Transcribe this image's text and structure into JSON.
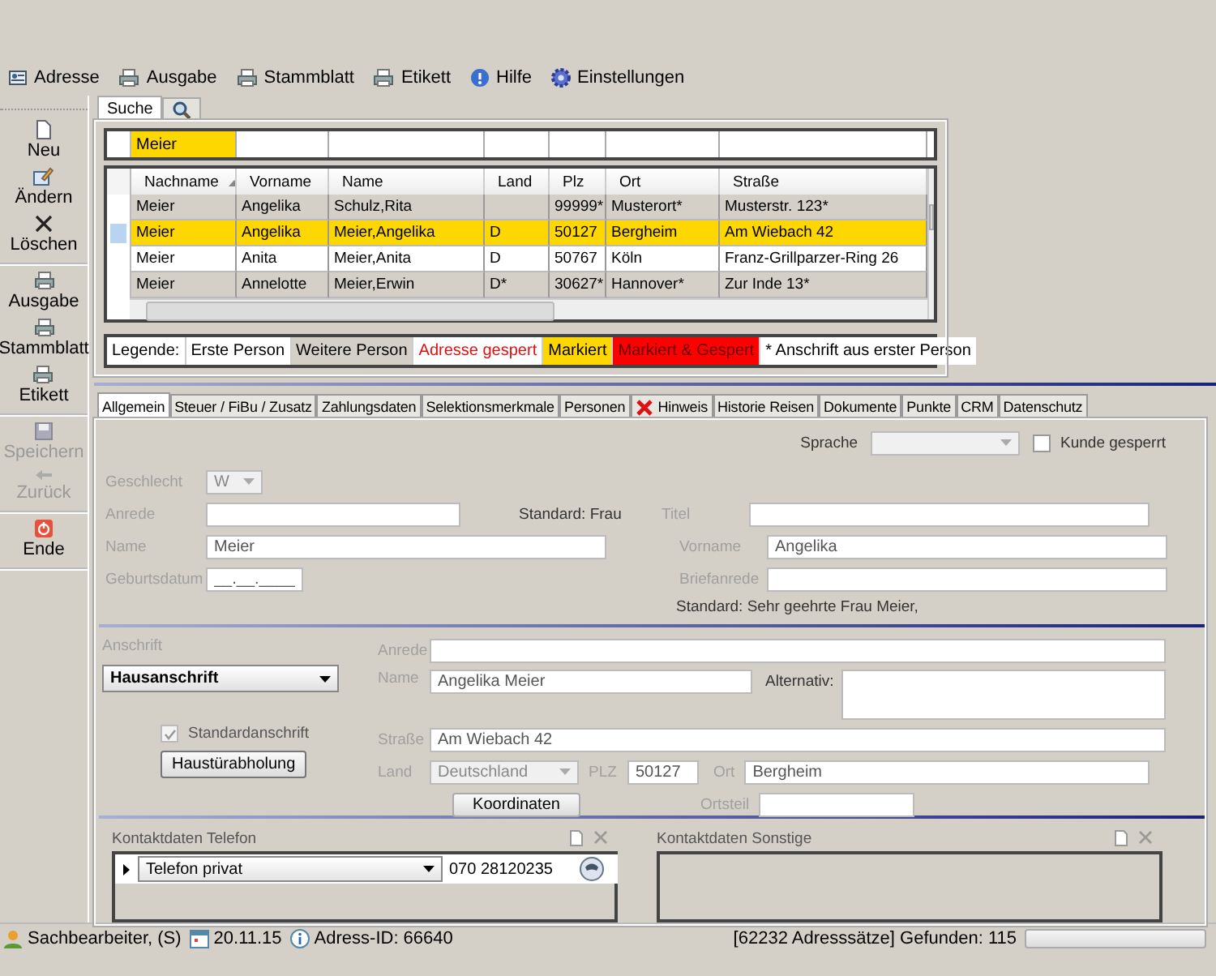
{
  "toolbar": [
    {
      "label": "Adresse",
      "kind": "address"
    },
    {
      "label": "Ausgabe",
      "kind": "print"
    },
    {
      "label": "Stammblatt",
      "kind": "print"
    },
    {
      "label": "Etikett",
      "kind": "print"
    },
    {
      "label": "Hilfe",
      "kind": "help"
    },
    {
      "label": "Einstellungen",
      "kind": "settings"
    }
  ],
  "sidebar": {
    "groups": [
      {
        "items": [
          {
            "label": "Neu",
            "kind": "new",
            "disabled": false
          },
          {
            "label": "Ändern",
            "kind": "edit",
            "disabled": false
          },
          {
            "label": "Löschen",
            "kind": "delete",
            "disabled": false
          }
        ]
      },
      {
        "items": [
          {
            "label": "Ausgabe",
            "kind": "print",
            "disabled": false
          },
          {
            "label": "Stammblatt",
            "kind": "print",
            "disabled": false
          },
          {
            "label": "Etikett",
            "kind": "print",
            "disabled": false
          }
        ]
      },
      {
        "items": [
          {
            "label": "Speichern",
            "kind": "save",
            "disabled": true
          },
          {
            "label": "Zurück",
            "kind": "back",
            "disabled": true
          }
        ]
      },
      {
        "items": [
          {
            "label": "Ende",
            "kind": "exit",
            "disabled": false
          }
        ]
      }
    ]
  },
  "search": {
    "tabs": [
      {
        "label": "Suche",
        "kind": "text",
        "selected": true
      },
      {
        "kind": "search",
        "selected": false
      }
    ],
    "filter": "Meier",
    "columns": [
      {
        "label": "Nachname",
        "sorted": true
      },
      {
        "label": "Vorname",
        "sorted": false
      },
      {
        "label": "Name",
        "sorted": false
      },
      {
        "label": "Land",
        "sorted": false
      },
      {
        "label": "Plz",
        "sorted": false
      },
      {
        "label": "Ort",
        "sorted": false
      },
      {
        "label": "Straße",
        "sorted": false
      }
    ],
    "rows": [
      {
        "cells": [
          "Meier",
          "Angelika",
          "Schulz,Rita",
          "",
          "99999*",
          "Musterort*",
          "Musterstr. 123*"
        ],
        "kind": "further",
        "selected": false
      },
      {
        "cells": [
          "Meier",
          "Angelika",
          "Meier,Angelika",
          "D",
          "50127",
          "Bergheim",
          "Am Wiebach 42"
        ],
        "kind": "marked",
        "selected": true
      },
      {
        "cells": [
          "Meier",
          "Anita",
          "Meier,Anita",
          "D",
          "50767",
          "Köln",
          "Franz-Grillparzer-Ring 26"
        ],
        "kind": "first",
        "selected": false
      },
      {
        "cells": [
          "Meier",
          "Annelotte",
          "Meier,Erwin",
          "D*",
          "30627*",
          "Hannover*",
          "Zur Inde 13*"
        ],
        "kind": "further",
        "selected": false
      }
    ],
    "legend": {
      "label": "Legende:",
      "items": [
        {
          "label": "Erste Person",
          "kind": "first"
        },
        {
          "label": "Weitere Person",
          "kind": "further"
        },
        {
          "label": "Adresse gespert",
          "kind": "blocked"
        },
        {
          "label": "Markiert",
          "kind": "marked"
        },
        {
          "label": "Markiert & Gespert",
          "kind": "marked_blocked"
        },
        {
          "label": "* Anschrift aus erster Person",
          "kind": "note"
        }
      ]
    }
  },
  "detail_tabs": [
    {
      "label": "Allgemein",
      "kind": "text",
      "selected": true
    },
    {
      "label": "Steuer / FiBu / Zusatz",
      "kind": "text",
      "selected": false
    },
    {
      "label": "Zahlungsdaten",
      "kind": "text",
      "selected": false
    },
    {
      "label": "Selektionsmerkmale",
      "kind": "text",
      "selected": false
    },
    {
      "label": "Personen",
      "kind": "text",
      "selected": false
    },
    {
      "label": "Hinweis",
      "kind": "warning",
      "selected": false
    },
    {
      "label": "Historie Reisen",
      "kind": "text",
      "selected": false
    },
    {
      "label": "Dokumente",
      "kind": "text",
      "selected": false
    },
    {
      "label": "Punkte",
      "kind": "text",
      "selected": false
    },
    {
      "label": "CRM",
      "kind": "text",
      "selected": false
    },
    {
      "label": "Datenschutz",
      "kind": "text",
      "selected": false
    }
  ],
  "person": {
    "sprache": {
      "label": "Sprache"
    },
    "kunde_gesperrt": {
      "label": "Kunde gesperrt",
      "checked": false
    },
    "geschlecht": {
      "label": "Geschlecht",
      "value": "W"
    },
    "anrede": {
      "label": "Anrede",
      "hint": "Standard: Frau"
    },
    "name": {
      "label": "Name",
      "value": "Meier"
    },
    "geburtsdatum": {
      "label": "Geburtsdatum",
      "value": "__.__.____"
    },
    "titel": {
      "label": "Titel"
    },
    "vorname": {
      "label": "Vorname",
      "value": "Angelika"
    },
    "briefanrede": {
      "label": "Briefanrede",
      "hint": "Standard: Sehr geehrte Frau Meier,"
    }
  },
  "address": {
    "label": "Anschrift",
    "type": "Hausanschrift",
    "standard": {
      "label": "Standardanschrift",
      "checked": true
    },
    "pickup_button": "Haustürabholung",
    "anrede": {
      "label": "Anrede"
    },
    "name": {
      "label": "Name",
      "value": "Angelika Meier"
    },
    "alternativ": {
      "label": "Alternativ:"
    },
    "strasse": {
      "label": "Straße",
      "value": "Am Wiebach 42"
    },
    "land": {
      "label": "Land",
      "value": "Deutschland"
    },
    "plz": {
      "label": "PLZ",
      "value": "50127"
    },
    "ort": {
      "label": "Ort",
      "value": "Bergheim"
    },
    "ortsteil": {
      "label": "Ortsteil"
    },
    "coords_button": "Koordinaten"
  },
  "contacts": [
    {
      "title": "Kontaktdaten Telefon",
      "rows": [
        {
          "type": "Telefon privat",
          "value": "070 28120235"
        }
      ]
    },
    {
      "title": "Kontaktdaten Sonstige"
    }
  ],
  "status_bar": {
    "user": "Sachbearbeiter, (S)",
    "date": "20.11.15",
    "address_id": "Adress-ID: 66640",
    "count": "[62232 Adresssätze] Gefunden: 115",
    "progress": {
      "level": 0
    }
  }
}
